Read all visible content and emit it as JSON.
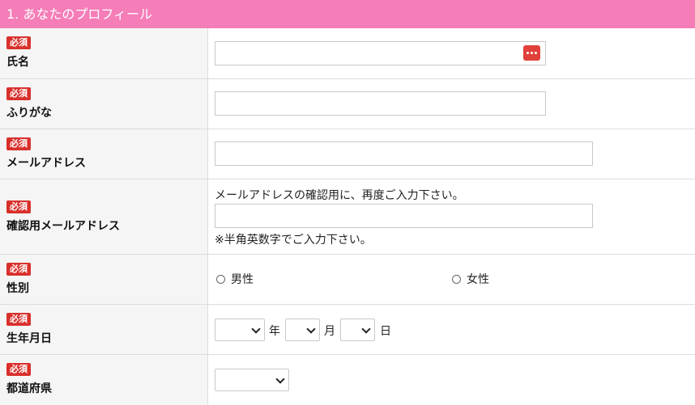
{
  "section": {
    "title": "1. あなたのプロフィール"
  },
  "required_label": "必須",
  "fields": {
    "name": {
      "label": "氏名",
      "value": ""
    },
    "furigana": {
      "label": "ふりがな",
      "value": ""
    },
    "email": {
      "label": "メールアドレス",
      "value": ""
    },
    "email_confirm": {
      "label": "確認用メールアドレス",
      "note_top": "メールアドレスの確認用に、再度ご入力下さい。",
      "note_bottom": "※半角英数字でご入力下さい。",
      "value": ""
    },
    "gender": {
      "label": "性別",
      "options": [
        "男性",
        "女性"
      ]
    },
    "birthday": {
      "label": "生年月日",
      "year_unit": "年",
      "month_unit": "月",
      "day_unit": "日"
    },
    "prefecture": {
      "label": "都道府県"
    }
  },
  "colors": {
    "header": "#f57db8",
    "badge": "#d9302c",
    "label_bg": "#f5f5f5"
  },
  "icons": {
    "password_manager": "dots-icon"
  }
}
